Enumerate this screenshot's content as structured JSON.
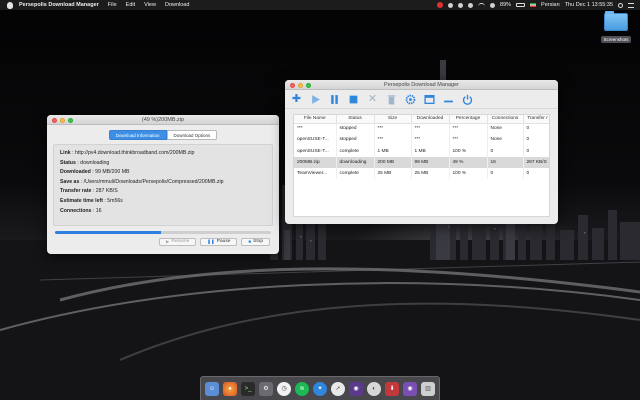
{
  "menubar": {
    "app_name": "Persepolis Download Manager",
    "items": [
      "File",
      "Edit",
      "View",
      "Download"
    ],
    "battery": "89%",
    "input_source": "Persian",
    "clock": "Thu Dec 1  13:55:35"
  },
  "desktop": {
    "folder_label": "Screenshots"
  },
  "progress_window": {
    "title": "(49 %)200MB.zip",
    "tabs": [
      "Download Information",
      "Download Options"
    ],
    "info": [
      {
        "label": "Link",
        "value": " : http://pv4.download.thinkbroadband.com/200MB.zip"
      },
      {
        "label": "Status",
        "value": " : downloading"
      },
      {
        "label": "Downloaded",
        "value": " : 99 MB/200 MB"
      },
      {
        "label": "Save as",
        "value": " : /Users/mmuli/Downloads/Persepolis/Compressed/200MB.zip"
      },
      {
        "label": "Transfer rate",
        "value": " : 287 KB/S"
      },
      {
        "label": "Estimate time left",
        "value": " : 5m56s"
      },
      {
        "label": "Connections",
        "value": " : 16"
      }
    ],
    "progress": 0.49,
    "buttons": {
      "resume": "Resume",
      "pause": "Pause",
      "stop": "Stop"
    }
  },
  "main_window": {
    "title": "Persepolis Download Manager",
    "columns": [
      "File Name",
      "Status",
      "Size",
      "Downloaded",
      "Percentage",
      "Connections",
      "Transfer r"
    ],
    "rows": [
      [
        "***",
        "stopped",
        "***",
        "***",
        "***",
        "None",
        "0"
      ],
      [
        "openSUSE-T...",
        "stopped",
        "***",
        "***",
        "***",
        "None",
        "0"
      ],
      [
        "openSUSE-T...",
        "complete",
        "1 MB",
        "1 MB",
        "100 %",
        "0",
        "0"
      ],
      [
        "200MB.zip",
        "downloading",
        "200 MB",
        "99 MB",
        "49 %",
        "16",
        "287 KB/S"
      ],
      [
        "TeamViewer...",
        "complete",
        "25 MB",
        "25 MB",
        "100 %",
        "0",
        "0"
      ]
    ],
    "selected_row": 3
  }
}
